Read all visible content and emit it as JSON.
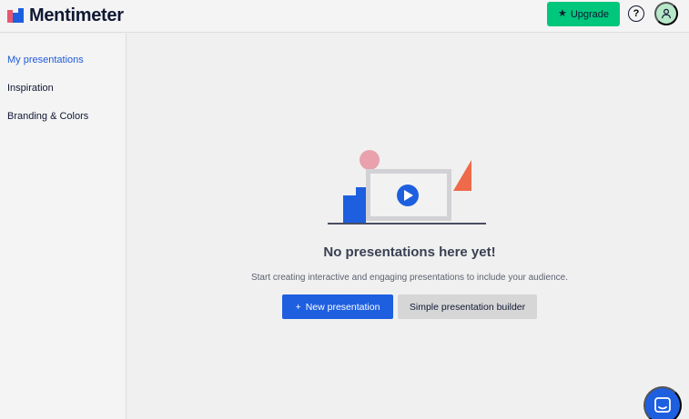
{
  "header": {
    "logo_text": "Mentimeter",
    "upgrade_label": "Upgrade",
    "help_label": "?"
  },
  "sidebar": {
    "items": [
      {
        "label": "My presentations",
        "active": true
      },
      {
        "label": "Inspiration",
        "active": false
      },
      {
        "label": "Branding & Colors",
        "active": false
      }
    ]
  },
  "main": {
    "empty_title": "No presentations here yet!",
    "empty_description": "Start creating interactive and engaging presentations to include your audience.",
    "new_presentation_plus": "+",
    "new_presentation_label": "New presentation",
    "simple_builder_label": "Simple presentation builder"
  },
  "icons": {
    "upgrade": "star-icon",
    "help": "question-circle-icon",
    "avatar": "user-icon",
    "chat": "chat-icon",
    "illustration_play": "play-icon"
  },
  "colors": {
    "accent_blue": "#1e5fe0",
    "upgrade_green": "#00c77b",
    "avatar_bg": "#b7e8c9",
    "active_link": "#1f5bd8",
    "illustration_pink": "#e8a1ad",
    "illustration_orange": "#ee6a4a"
  }
}
